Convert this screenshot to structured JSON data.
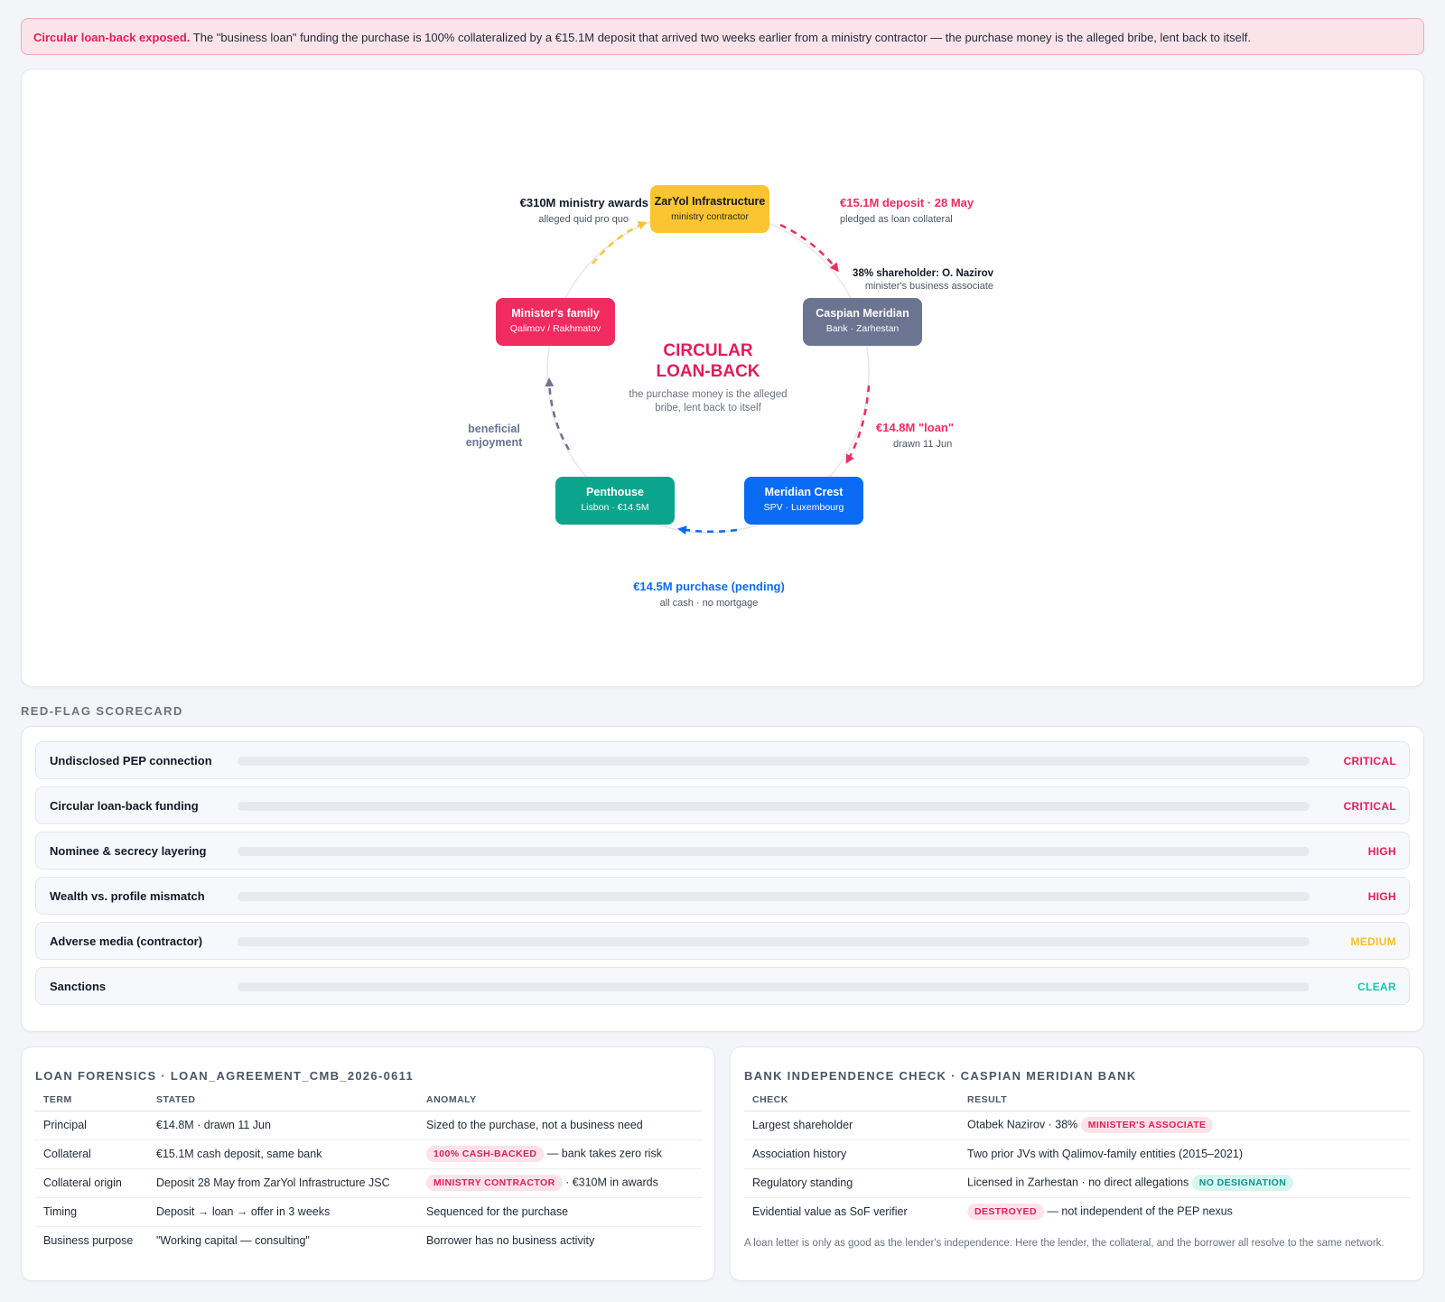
{
  "alert": {
    "title": "Circular loan-back exposed.",
    "text": "The \"business loan\" funding the purchase is 100% collateralized by a €15.1M deposit that arrived two weeks earlier from a ministry contractor — the purchase money is the alleged bribe, lent back to itself."
  },
  "diagram": {
    "center_title_line1": "CIRCULAR",
    "center_title_line2": "LOAN-BACK",
    "center_sub_line1": "the purchase money is the alleged",
    "center_sub_line2": "bribe, lent back to itself",
    "nodes": {
      "contractor": {
        "title": "ZarYol Infrastructure",
        "sub": "ministry contractor",
        "color": "#fbc531"
      },
      "bank": {
        "title": "Caspian Meridian",
        "sub": "Bank · Zarhestan",
        "color": "#6b7491"
      },
      "spv": {
        "title": "Meridian Crest",
        "sub": "SPV · Luxembourg",
        "color": "#0a6cf5"
      },
      "penthouse": {
        "title": "Penthouse",
        "sub": "Lisbon · €14.5M",
        "color": "#0ba58d"
      },
      "family": {
        "title": "Minister's family",
        "sub": "Qalimov / Rakhmatov",
        "color": "#f12b5f"
      }
    },
    "edges": {
      "deposit": {
        "title": "€15.1M deposit · 28 May",
        "sub": "pledged as loan collateral",
        "color": "#f12b5f"
      },
      "shareholder": {
        "title": "38% shareholder: O. Nazirov",
        "sub": "minister's business associate"
      },
      "loan": {
        "title": "€14.8M \"loan\"",
        "sub": "drawn 11 Jun",
        "color": "#f12b5f"
      },
      "purchase": {
        "title": "€14.5M purchase (pending)",
        "sub": "all cash · no mortgage",
        "color": "#0a6cf5"
      },
      "enjoyment": {
        "title_line1": "beneficial",
        "title_line2": "enjoyment",
        "color": "#6b7491"
      },
      "awards": {
        "title": "€310M ministry awards",
        "sub": "alleged quid pro quo",
        "color": "#fbc531"
      }
    }
  },
  "scorecard": {
    "title": "RED-FLAG SCORECARD",
    "colors": {
      "CRITICAL": "#e11d57",
      "HIGH": "#e11d57",
      "MEDIUM": "#fbbf24",
      "CLEAR": "#14c8b0"
    },
    "flags": [
      {
        "label": "Undisclosed PEP connection",
        "level": "CRITICAL"
      },
      {
        "label": "Circular loan-back funding",
        "level": "CRITICAL"
      },
      {
        "label": "Nominee & secrecy layering",
        "level": "HIGH"
      },
      {
        "label": "Wealth vs. profile mismatch",
        "level": "HIGH"
      },
      {
        "label": "Adverse media (contractor)",
        "level": "MEDIUM"
      },
      {
        "label": "Sanctions",
        "level": "CLEAR"
      }
    ]
  },
  "loan": {
    "title": "LOAN FORENSICS · LOAN_AGREEMENT_CMB_2026-0611",
    "headers": [
      "TERM",
      "STATED",
      "ANOMALY"
    ],
    "rows": [
      {
        "term": "Principal",
        "stated": "€14.8M · drawn 11 Jun",
        "tag": "",
        "anomaly": "Sized to the purchase, not a business need"
      },
      {
        "term": "Collateral",
        "stated": "€15.1M cash deposit, same bank",
        "tag": "100% CASH-BACKED",
        "anomaly": "— bank takes zero risk"
      },
      {
        "term": "Collateral origin",
        "stated": "Deposit 28 May from ZarYol Infrastructure JSC",
        "tag": "MINISTRY CONTRACTOR",
        "anomaly": "· €310M in awards"
      },
      {
        "term": "Timing",
        "stated": "Deposit → loan → offer in 3 weeks",
        "tag": "",
        "anomaly": "Sequenced for the purchase"
      },
      {
        "term": "Business purpose",
        "stated": "\"Working capital — consulting\"",
        "tag": "",
        "anomaly": "Borrower has no business activity"
      }
    ]
  },
  "bank": {
    "title": "BANK INDEPENDENCE CHECK · CASPIAN MERIDIAN BANK",
    "headers": [
      "CHECK",
      "RESULT"
    ],
    "rows": [
      {
        "check": "Largest shareholder",
        "result": "Otabek Nazirov · 38%",
        "tag": "MINISTER'S ASSOCIATE",
        "tag_kind": "red",
        "after": ""
      },
      {
        "check": "Association history",
        "result": "Two prior JVs with Qalimov-family entities (2015–2021)",
        "tag": "",
        "tag_kind": "",
        "after": ""
      },
      {
        "check": "Regulatory standing",
        "result": "Licensed in Zarhestan · no direct allegations",
        "tag": "NO DESIGNATION",
        "tag_kind": "green",
        "after": ""
      },
      {
        "check": "Evidential value as SoF verifier",
        "result": "",
        "tag": "DESTROYED",
        "tag_kind": "red",
        "after": "— not independent of the PEP nexus"
      }
    ],
    "note": "A loan letter is only as good as the lender's independence. Here the lender, the collateral, and the borrower all resolve to the same network."
  }
}
